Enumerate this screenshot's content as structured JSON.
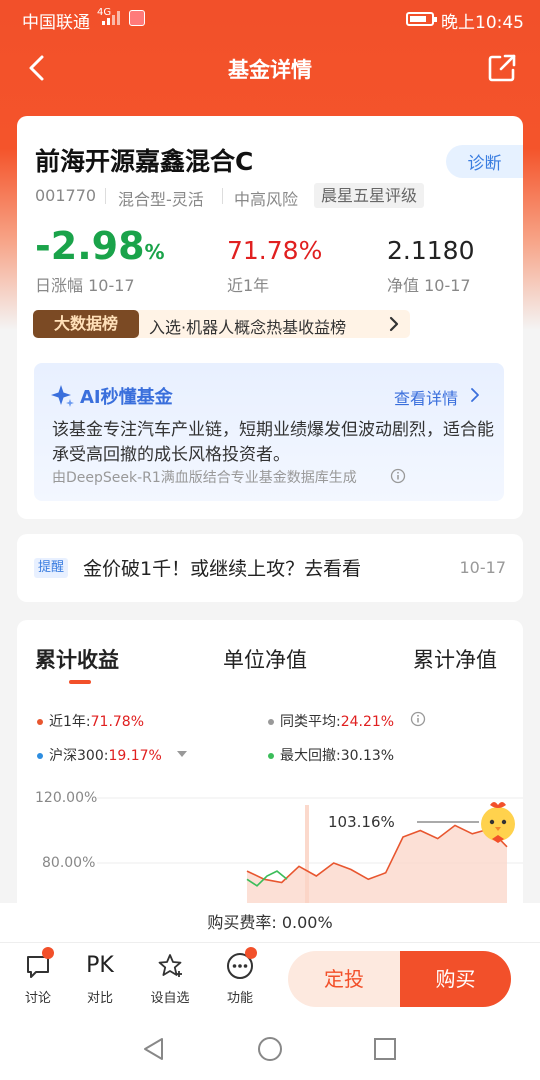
{
  "status_bar": {
    "carrier": "中国联通",
    "signal": "4G",
    "time": "晚上10:45"
  },
  "header": {
    "title": "基金详情"
  },
  "fund": {
    "name": "前海开源嘉鑫混合C",
    "diagnose_label": "诊断",
    "code": "001770",
    "type": "混合型-灵活",
    "risk": "中高风险",
    "rating": "晨星五星评级",
    "daily_change_value": "-2.98",
    "daily_change_unit": "%",
    "daily_change_label": "日涨幅 10-17",
    "year_return": "71.78%",
    "year_return_label": "近1年",
    "nav": "2.1180",
    "nav_label": "净值 10-17",
    "rank_tag": "大数据榜",
    "rank_text": "入选·机器人概念热基收益榜"
  },
  "ai": {
    "title": "AI秒懂基金",
    "more": "查看详情",
    "description": "该基金专注汽车产业链，短期业绩爆发但波动剧烈，适合能承受高回撤的成长风格投资者。",
    "source": "由DeepSeek-R1满血版结合专业基金数据库生成"
  },
  "notice": {
    "badge": "提醒",
    "text": "金价破1千！或继续上攻？去看看",
    "date": "10-17"
  },
  "chart_tabs": [
    "累计收益",
    "单位净值",
    "累计净值"
  ],
  "legend": {
    "fund_label": "近1年:",
    "fund_value": "71.78%",
    "peer_label": "同类平均:",
    "peer_value": "24.21%",
    "index_label": "沪深300:",
    "index_value": "19.17%",
    "drawdown_label": "最大回撤:",
    "drawdown_value": "30.13%"
  },
  "colors": {
    "brand": "#f2502a",
    "up": "#e02020",
    "down": "#1aa34a",
    "ai_blue": "#3a6fdc"
  },
  "chart_data": {
    "type": "line",
    "yticks": [
      "120.00%",
      "80.00%"
    ],
    "ylim": [
      60,
      130
    ],
    "peak_label": "103.16%",
    "series": [
      {
        "name": "近1年",
        "color": "#e8562f",
        "values": [
          75,
          70,
          68,
          78,
          72,
          80,
          76,
          70,
          74,
          96,
          100,
          95,
          103.16,
          98,
          101,
          90
        ]
      },
      {
        "name": "最大回撤",
        "color": "#3bbd5a",
        "values": [
          70,
          66,
          72,
          75,
          70
        ]
      }
    ]
  },
  "footer": {
    "fee": "购买费率: 0.00%",
    "actions": [
      "讨论",
      "对比",
      "设自选",
      "功能"
    ],
    "pk_label": "PK",
    "dingtou": "定投",
    "buy": "购买"
  }
}
